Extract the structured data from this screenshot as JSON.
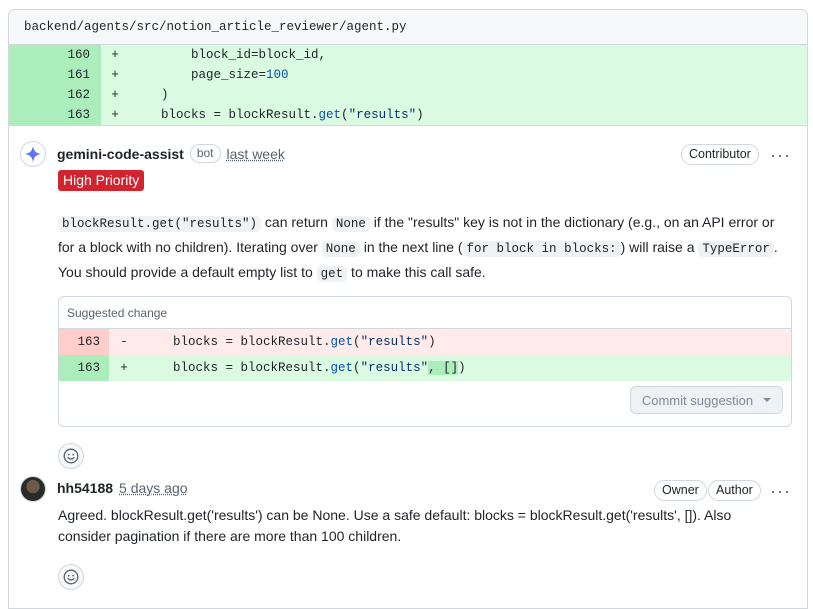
{
  "file": {
    "path": "backend/agents/src/notion_article_reviewer/agent.py"
  },
  "diff": {
    "lines": [
      {
        "num": "160",
        "sign": "+",
        "pre": "        block_id=block_id,",
        "parts": []
      },
      {
        "num": "161",
        "sign": "+",
        "pre": "        page_size=",
        "num_val": "100"
      },
      {
        "num": "162",
        "sign": "+",
        "pre": "    )"
      },
      {
        "num": "163",
        "sign": "+",
        "pre": "    blocks = blockResult.",
        "fn": "get",
        "paren_open": "(",
        "str": "\"results\"",
        "paren_close": ")"
      }
    ]
  },
  "comment1": {
    "author": "gemini-code-assist",
    "badge": "bot",
    "time": "last week",
    "role": "Contributor",
    "priority": "High Priority",
    "code1": "blockResult.get(\"results\")",
    "t1": " can return ",
    "code2": "None",
    "t2": " if the \"results\" key is not in the dictionary (e.g., on an API error or for a block with no children). Iterating over ",
    "code3": "None",
    "t3": " in the next line (",
    "code4": "for block in blocks:",
    "t4": ") will raise a ",
    "code5": "TypeError",
    "t5": ". You should provide a default empty list to ",
    "code6": "get",
    "t6": " to make this call safe.",
    "suggestion": {
      "header": "Suggested change",
      "del": {
        "num": "163",
        "sign": "-",
        "pre": "    blocks = blockResult.",
        "fn": "get",
        "po": "(",
        "str": "\"results\"",
        "pc": ")"
      },
      "add": {
        "num": "163",
        "sign": "+",
        "pre": "    blocks = blockResult.",
        "fn": "get",
        "po": "(",
        "str": "\"results\"",
        "extra": ", []",
        "pc": ")"
      },
      "commit_label": "Commit suggestion"
    }
  },
  "comment2": {
    "author": "hh54188",
    "time": "5 days ago",
    "role1": "Owner",
    "role2": "Author",
    "text": "Agreed. blockResult.get('results') can be None. Use a safe default: blocks = blockResult.get('results', []). Also consider pagination if there are more than 100 children."
  },
  "icons": {
    "gemini": "sparkle-icon",
    "menu": "kebab-icon",
    "react": "smiley-icon"
  },
  "colors": {
    "priority": "#d1242f",
    "added": "#dafbe1",
    "removed": "#ffebe9"
  }
}
